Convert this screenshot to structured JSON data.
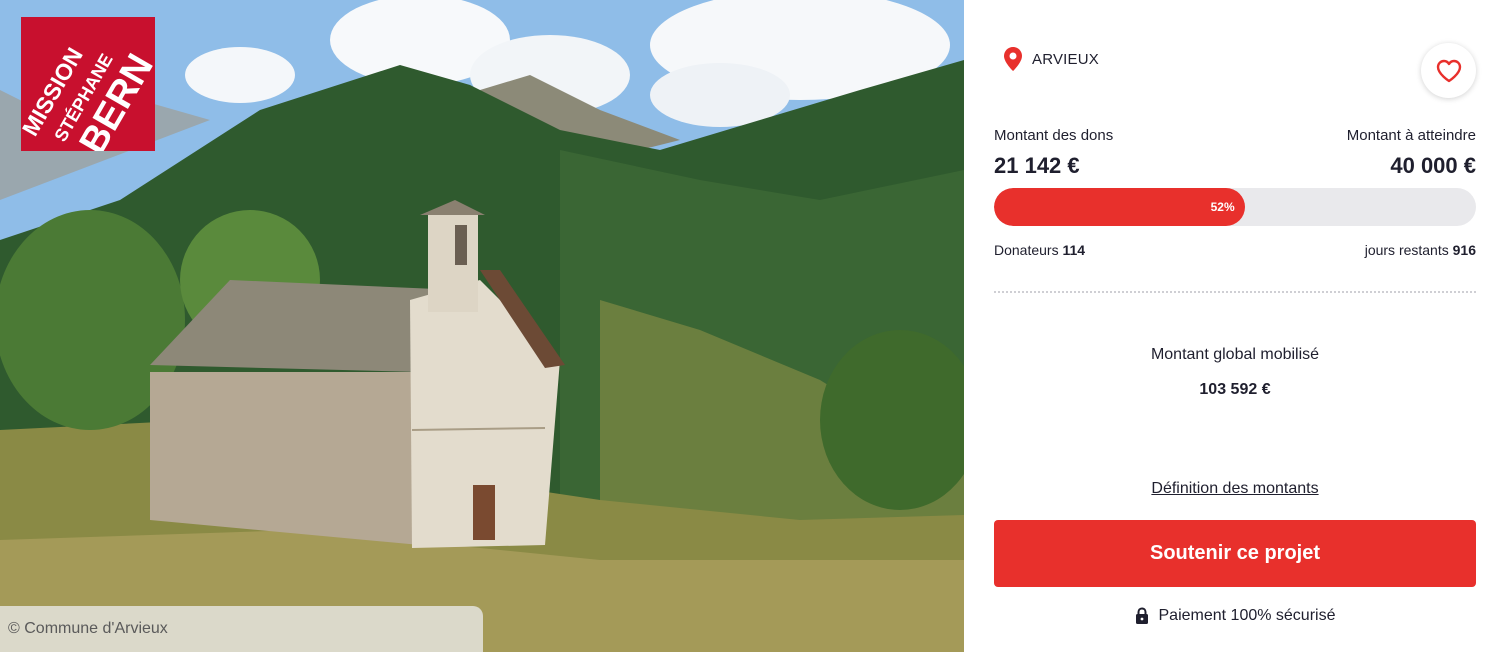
{
  "photo": {
    "logo_lines": [
      "MISSION",
      "STÉPHANE",
      "BERN"
    ],
    "credit": "© Commune d'Arvieux"
  },
  "project": {
    "location": "ARVIEUX",
    "favorite_icon": "heart-icon",
    "location_icon": "map-pin-icon"
  },
  "funding": {
    "raised_label": "Montant des dons",
    "raised_value": "21 142 €",
    "goal_label": "Montant à atteindre",
    "goal_value": "40 000 €",
    "progress_percent": 52,
    "progress_label": "52%",
    "donors_label": "Donateurs",
    "donors_count": "114",
    "days_label": "jours restants",
    "days_count": "916"
  },
  "global": {
    "label": "Montant global mobilisé",
    "value": "103 592 €"
  },
  "actions": {
    "definition_link": "Définition des montants",
    "support_button": "Soutenir ce projet",
    "secure_text": "Paiement 100% sécurisé"
  },
  "colors": {
    "accent": "#e8302c",
    "logo_red": "#c8102e",
    "progress_track": "#e9e9ec",
    "text": "#1f1f2e"
  }
}
